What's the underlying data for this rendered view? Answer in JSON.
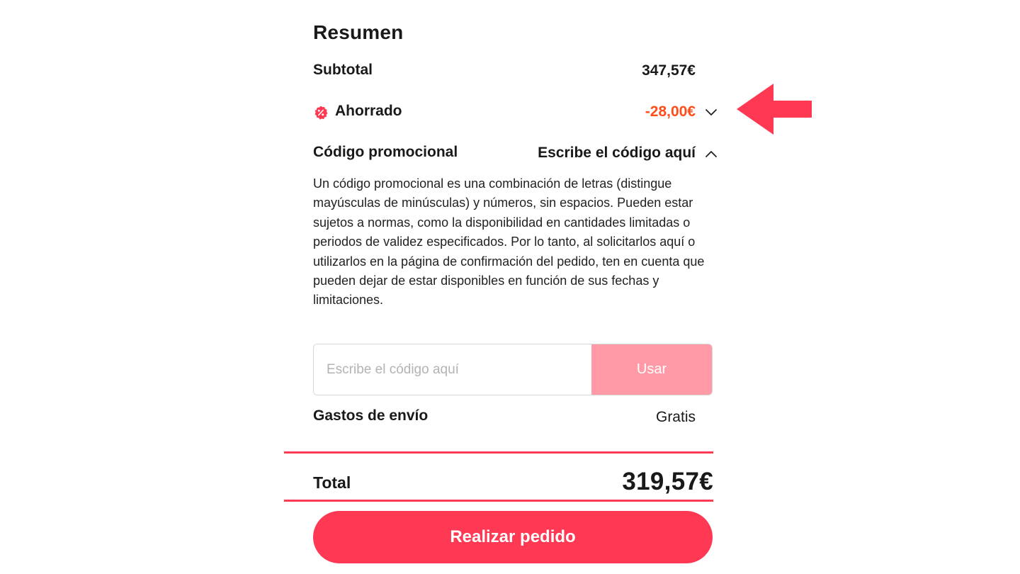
{
  "summary": {
    "title": "Resumen",
    "subtotal": {
      "label": "Subtotal",
      "value": "347,57€"
    },
    "saved": {
      "label": "Ahorrado",
      "value": "-28,00€",
      "icon": "discount-badge-icon",
      "chevron": "chevron-down-icon"
    },
    "promo": {
      "label": "Código promocional",
      "toggle_label": "Escribe el código aquí",
      "chevron": "chevron-up-icon",
      "description": "Un código promocional es una combinación de letras (distingue mayúsculas de minúsculas) y números, sin espacios. Pueden estar sujetos a normas, como la disponibilidad en cantidades limitadas o periodos de validez especificados. Por lo tanto, al solicitarlos aquí o utilizarlos en la página de confirmación del pedido, ten en cuenta que pueden dejar de estar disponibles en función de sus fechas y limitaciones.",
      "input_placeholder": "Escribe el código aquí",
      "input_value": "",
      "apply_label": "Usar"
    },
    "shipping": {
      "label": "Gastos de envío",
      "value": "Gratis"
    },
    "total": {
      "label": "Total",
      "value": "319,57€"
    },
    "order_button": "Realizar pedido"
  },
  "annotation": {
    "icon": "arrow-left-icon"
  },
  "colors": {
    "accent": "#ff3953",
    "discount": "#ff4d1a",
    "apply_disabled": "#ff9aa6",
    "highlight_line": "#ff3b55",
    "arrow": "#ff3953"
  }
}
